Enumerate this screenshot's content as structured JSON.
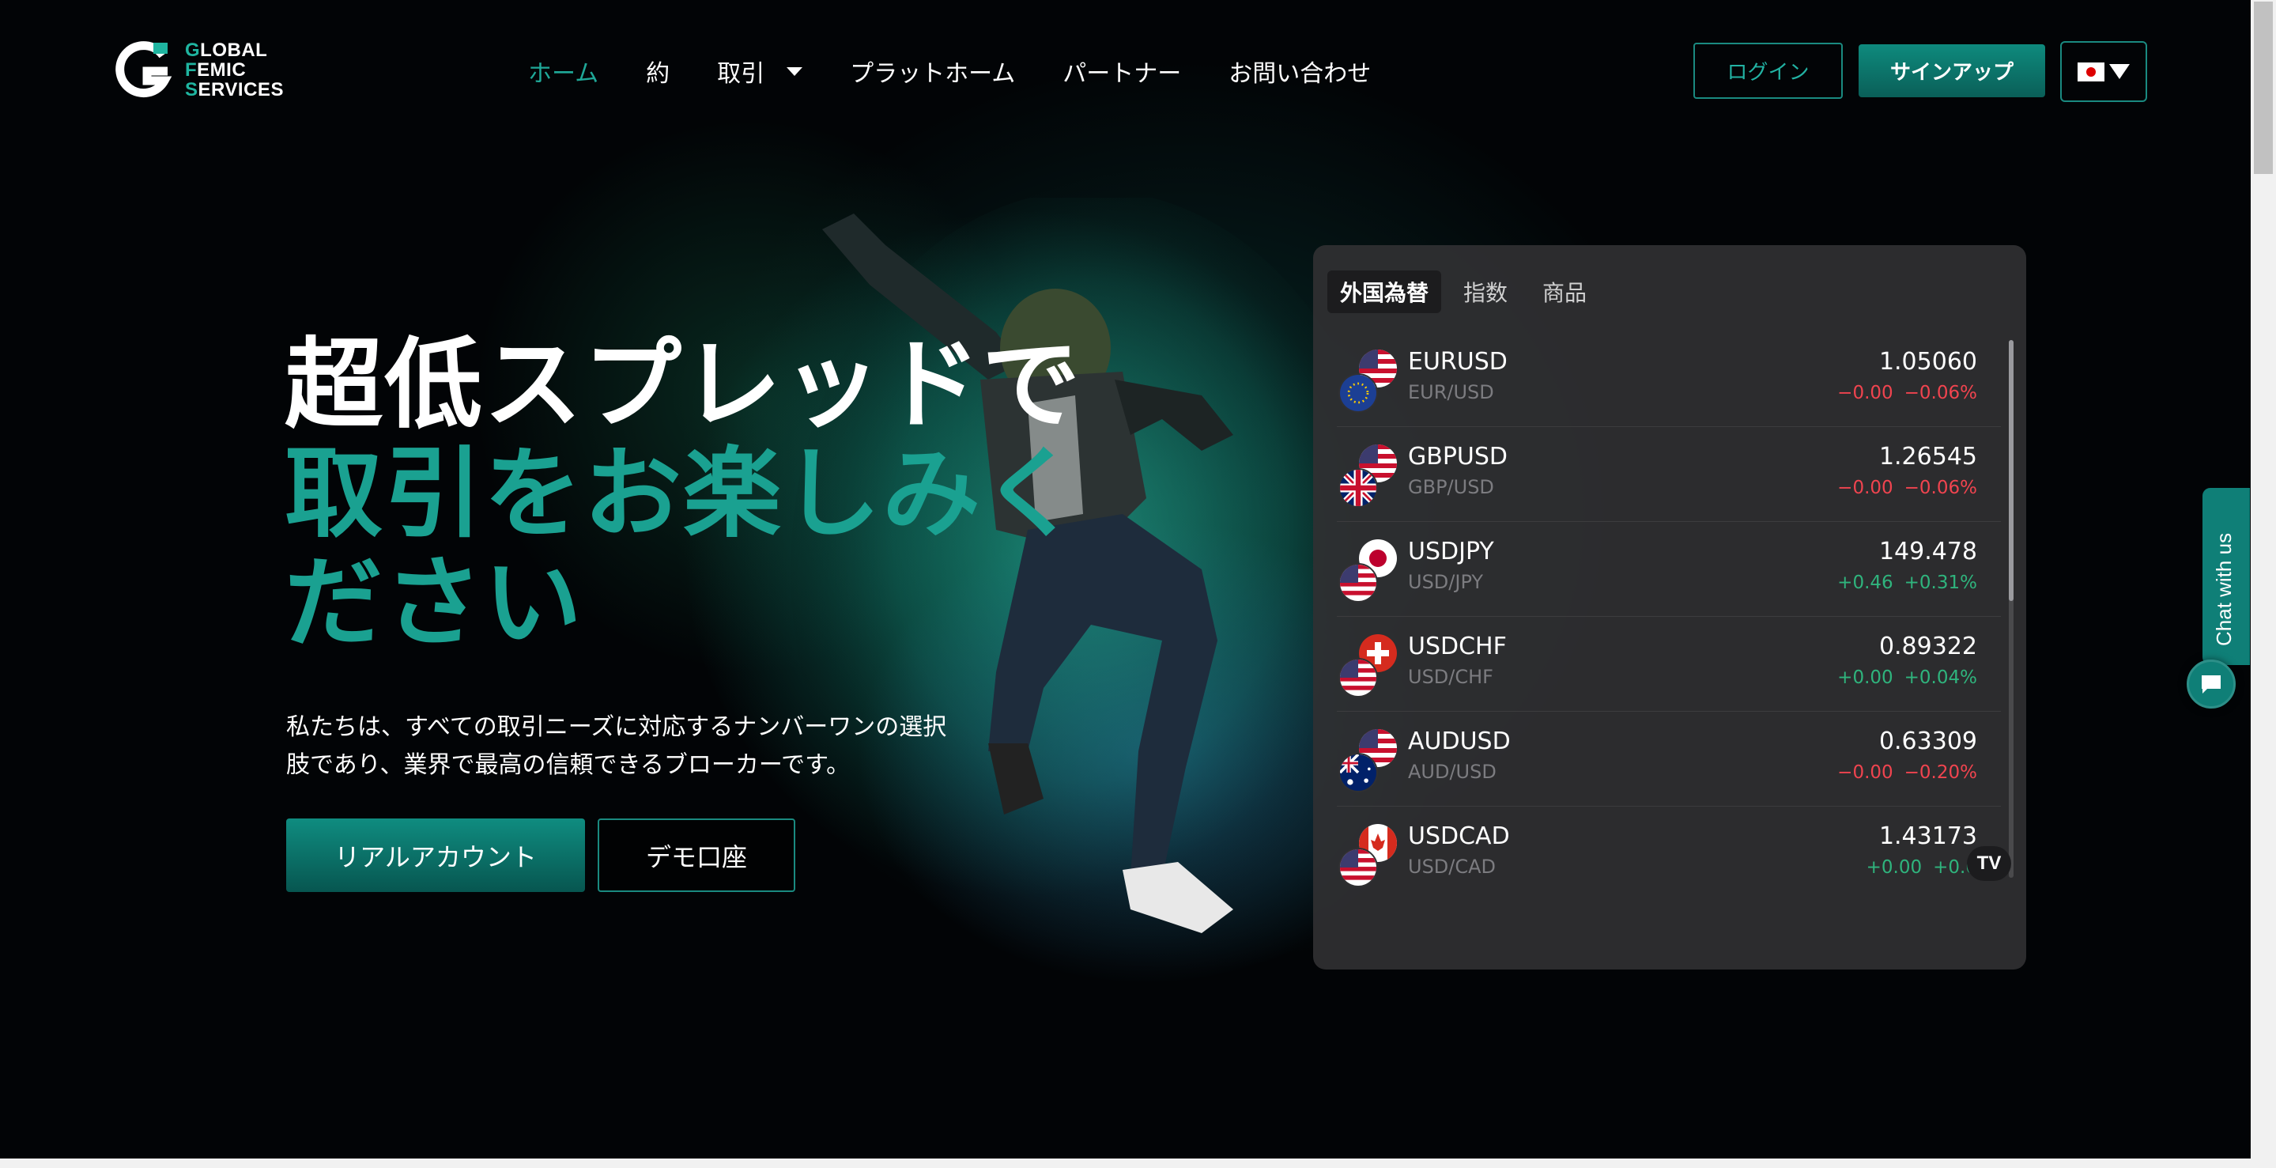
{
  "brand": {
    "logo_line1_first": "G",
    "logo_line1_rest": "LOBAL",
    "logo_line2_first": "F",
    "logo_line2_rest": "EMIC",
    "logo_line3_first": "S",
    "logo_line3_rest": "ERVICES",
    "accent_color": "#1fb5a0"
  },
  "nav": {
    "items": [
      {
        "label": "ホーム",
        "active": true
      },
      {
        "label": "約"
      },
      {
        "label": "取引",
        "has_dropdown": true
      },
      {
        "label": "プラットホーム"
      },
      {
        "label": "パートナー"
      },
      {
        "label": "お問い合わせ"
      }
    ],
    "login_label": "ログイン",
    "signup_label": "サインアップ",
    "language_flag": "japan-flag-icon"
  },
  "hero": {
    "title_line1": "超低スプレッドで",
    "title_line2": "取引をお楽しみく",
    "title_line3": "ださい",
    "description_line1": "私たちは、すべての取引ニーズに対応するナンバーワンの選択",
    "description_line2": "肢であり、業界で最高の信頼できるブローカーです。",
    "real_account_label": "リアルアカウント",
    "demo_label": "デモ口座"
  },
  "market_widget": {
    "tabs": [
      {
        "label": "外国為替",
        "active": true
      },
      {
        "label": "指数"
      },
      {
        "label": "商品"
      }
    ],
    "rows": [
      {
        "symbol": "EURUSD",
        "pair": "EUR/USD",
        "price": "1.05060",
        "change": "−0.00",
        "change_pct": "−0.06%",
        "direction": "down",
        "front_flag": "eu-flag-icon",
        "back_flag": "us-flag-icon"
      },
      {
        "symbol": "GBPUSD",
        "pair": "GBP/USD",
        "price": "1.26545",
        "change": "−0.00",
        "change_pct": "−0.06%",
        "direction": "down",
        "front_flag": "uk-flag-icon",
        "back_flag": "us-flag-icon"
      },
      {
        "symbol": "USDJPY",
        "pair": "USD/JPY",
        "price": "149.478",
        "change": "+0.46",
        "change_pct": "+0.31%",
        "direction": "up",
        "front_flag": "us-flag-icon",
        "back_flag": "japan-flag-icon"
      },
      {
        "symbol": "USDCHF",
        "pair": "USD/CHF",
        "price": "0.89322",
        "change": "+0.00",
        "change_pct": "+0.04%",
        "direction": "up",
        "front_flag": "us-flag-icon",
        "back_flag": "swiss-flag-icon"
      },
      {
        "symbol": "AUDUSD",
        "pair": "AUD/USD",
        "price": "0.63309",
        "change": "−0.00",
        "change_pct": "−0.20%",
        "direction": "down",
        "front_flag": "australia-flag-icon",
        "back_flag": "us-flag-icon"
      },
      {
        "symbol": "USDCAD",
        "pair": "USD/CAD",
        "price": "1.43173",
        "change": "+0.00",
        "change_pct": "+0.0",
        "direction": "up",
        "front_flag": "us-flag-icon",
        "back_flag": "canada-flag-icon"
      }
    ],
    "badge": "TV",
    "up_color": "#2fb47d",
    "down_color": "#f0444f"
  },
  "chat": {
    "tab_label": "Chat with us"
  }
}
